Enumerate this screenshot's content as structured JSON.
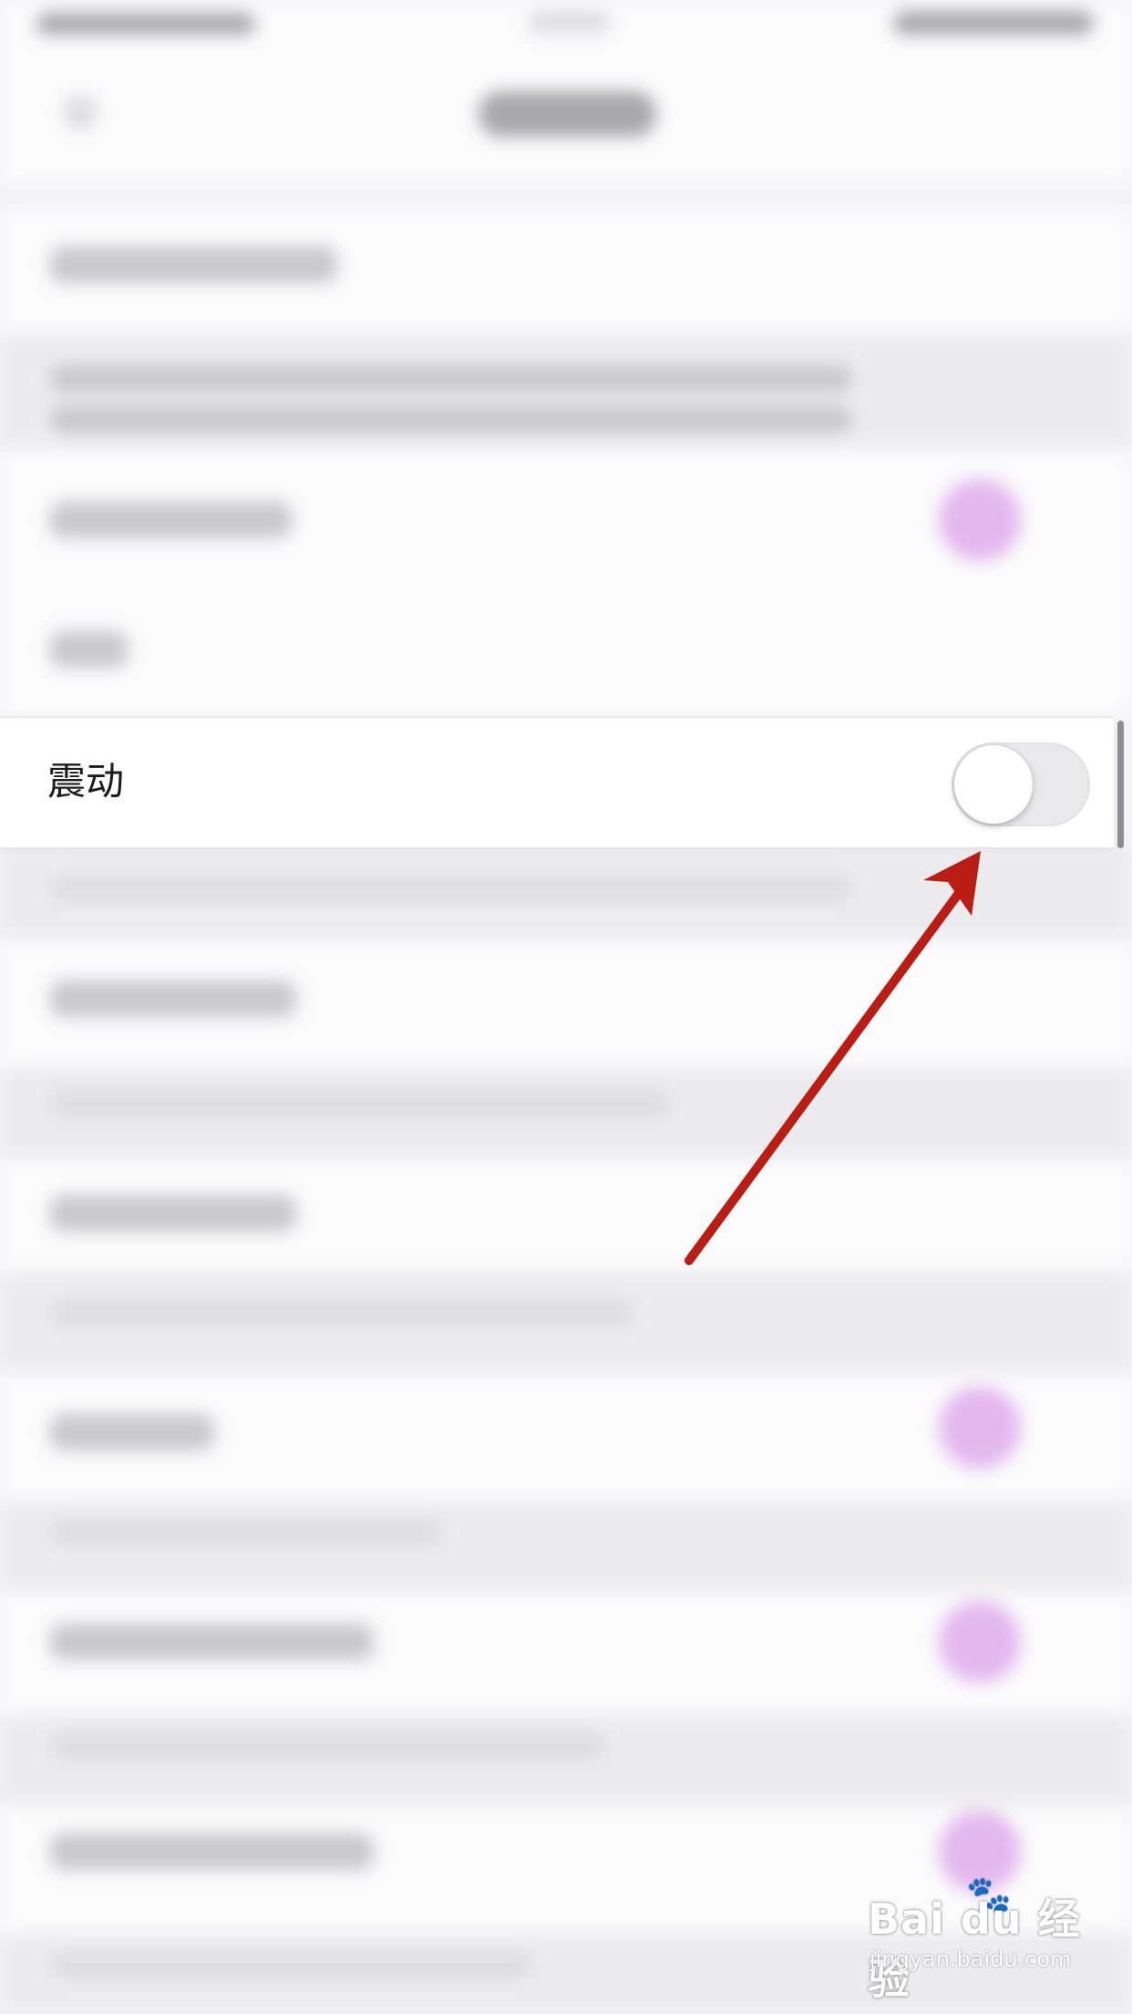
{
  "settings": {
    "vibration": {
      "label": "震动",
      "enabled": false
    }
  },
  "annotation": {
    "arrow_color": "#b91d14"
  },
  "watermark": {
    "brand": "Bai du 经验",
    "url": "jingyan.baidu.com"
  },
  "colors": {
    "accent_blurred": "#e4b8ef",
    "background": "#f4f3f6"
  }
}
